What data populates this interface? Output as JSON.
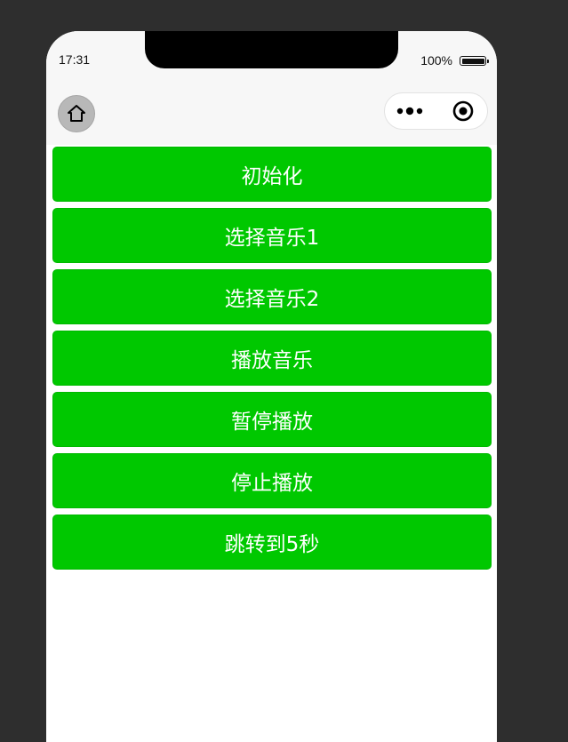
{
  "status_bar": {
    "time": "17:31",
    "battery_percent": "100%",
    "battery_level": 1.0
  },
  "nav": {
    "home_icon": "home-icon",
    "more_icon": "more-dots-icon",
    "close_icon": "target-circle-icon"
  },
  "buttons": [
    "初始化",
    "选择音乐1",
    "选择音乐2",
    "播放音乐",
    "暂停播放",
    "停止播放",
    "跳转到5秒"
  ],
  "colors": {
    "button_bg": "#00c800",
    "button_text": "#ffffff",
    "page_bg": "#2e2e2e"
  }
}
